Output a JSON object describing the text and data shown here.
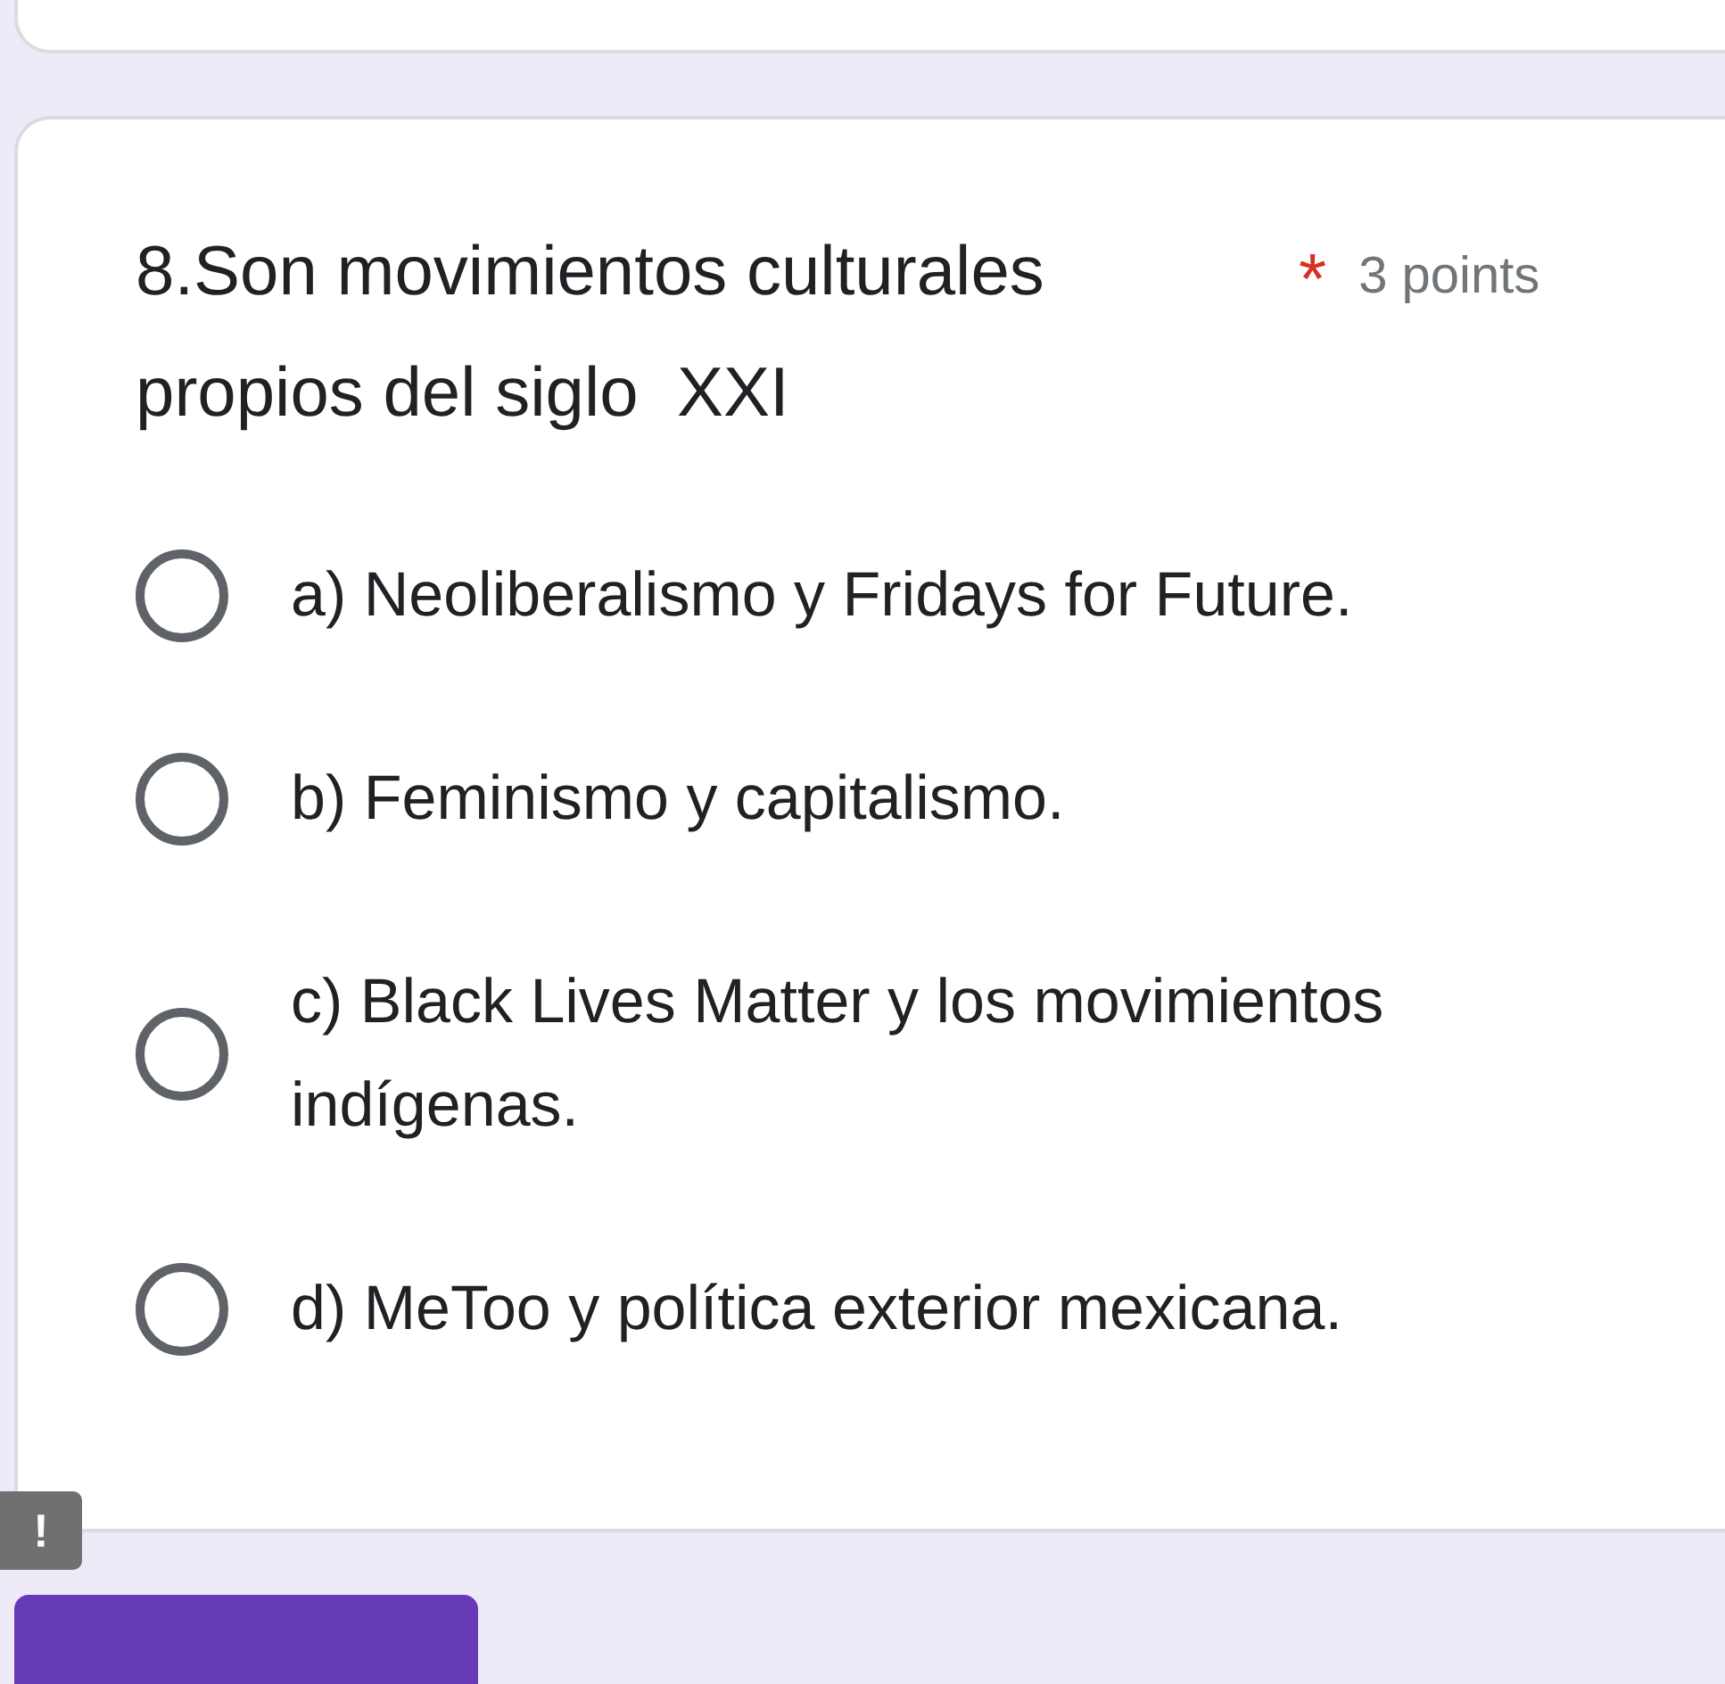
{
  "question": {
    "title": "8.Son movimientos culturales propios del siglo  XXI",
    "required_mark": "*",
    "points": "3 points",
    "options": [
      {
        "label": "a) Neoliberalismo y Fridays for Future.",
        "selected": false
      },
      {
        "label": "b) Feminismo y capitalismo.",
        "selected": false
      },
      {
        "label": "c) Black Lives Matter y los movimientos indígenas.",
        "selected": false
      },
      {
        "label": "d) MeToo y política exterior mexicana.",
        "selected": false
      }
    ]
  },
  "alert_badge": "!"
}
